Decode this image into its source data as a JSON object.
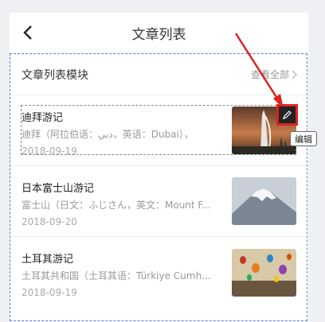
{
  "header": {
    "title": "文章列表",
    "back_icon": "chevron-left-icon"
  },
  "module": {
    "title": "文章列表模块",
    "view_all": "查看全部"
  },
  "articles": [
    {
      "title": "迪拜游记",
      "summary": "迪拜（阿拉伯语：دبي，英语：Dubai），",
      "date": "2018-09-19",
      "image": "dubai-photo"
    },
    {
      "title": "日本富士山游记",
      "summary": "富士山（日文：ふじさん，英文：Mount F...",
      "date": "2018-09-20",
      "image": "mount-fuji-photo"
    },
    {
      "title": "土耳其游记",
      "summary": "土耳其共和国（土耳其语：Türkiye Cumh...",
      "date": "2018-09-19",
      "image": "hot-air-balloons-photo"
    }
  ],
  "edit": {
    "tooltip": "编辑",
    "icon": "pencil-icon"
  },
  "colors": {
    "accent_red": "#e02020",
    "selection_blue": "#5a7ccf"
  }
}
